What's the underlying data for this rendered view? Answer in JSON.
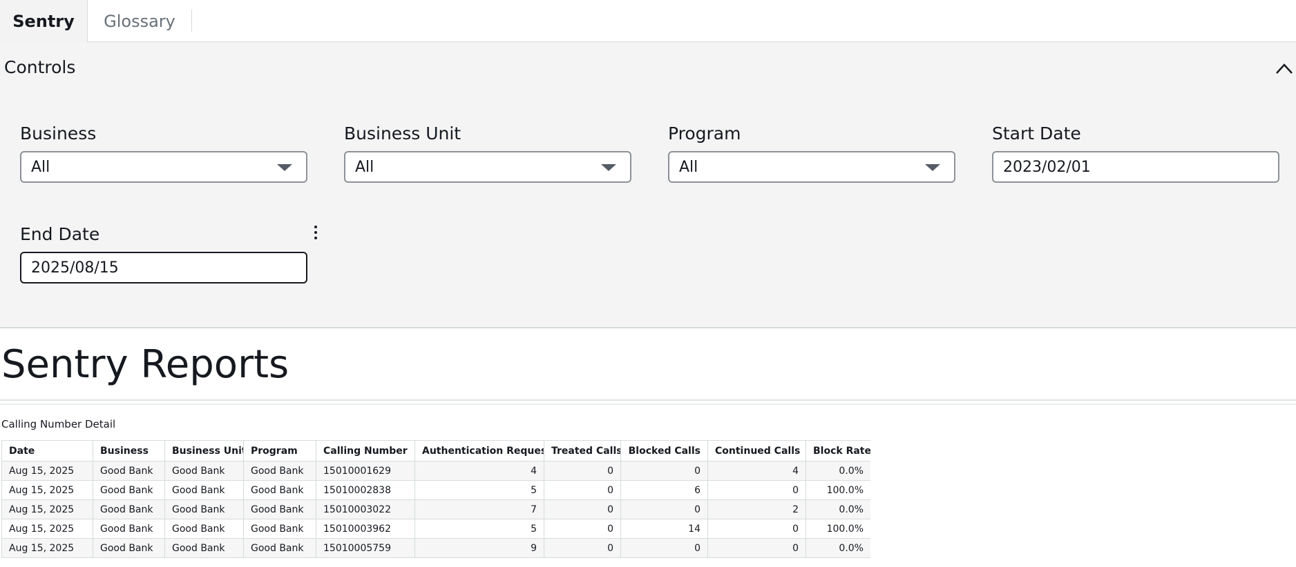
{
  "tabs": [
    {
      "label": "Sentry",
      "active": true
    },
    {
      "label": "Glossary",
      "active": false
    }
  ],
  "controls": {
    "title": "Controls",
    "business": {
      "label": "Business",
      "value": "All"
    },
    "business_unit": {
      "label": "Business Unit",
      "value": "All"
    },
    "program": {
      "label": "Program",
      "value": "All"
    },
    "start_date": {
      "label": "Start Date",
      "value": "2023/02/01"
    },
    "end_date": {
      "label": "End Date",
      "value": "2025/08/15"
    }
  },
  "report": {
    "title": "Sentry Reports",
    "visual_title": "Calling Number Detail"
  },
  "table": {
    "headers": [
      "Date",
      "Business",
      "Business Unit",
      "Program",
      "Calling Number",
      "Authentication Requests",
      "Treated Calls",
      "Blocked Calls",
      "Continued Calls",
      "Block Rate"
    ],
    "rows": [
      [
        "Aug 15, 2025",
        "Good Bank",
        "Good Bank",
        "Good Bank",
        "15010001629",
        "4",
        "0",
        "0",
        "4",
        "0.0%"
      ],
      [
        "Aug 15, 2025",
        "Good Bank",
        "Good Bank",
        "Good Bank",
        "15010002838",
        "5",
        "0",
        "6",
        "0",
        "100.0%"
      ],
      [
        "Aug 15, 2025",
        "Good Bank",
        "Good Bank",
        "Good Bank",
        "15010003022",
        "7",
        "0",
        "0",
        "2",
        "0.0%"
      ],
      [
        "Aug 15, 2025",
        "Good Bank",
        "Good Bank",
        "Good Bank",
        "15010003962",
        "5",
        "0",
        "14",
        "0",
        "100.0%"
      ],
      [
        "Aug 15, 2025",
        "Good Bank",
        "Good Bank",
        "Good Bank",
        "15010005759",
        "9",
        "0",
        "0",
        "0",
        "0.0%"
      ]
    ]
  }
}
